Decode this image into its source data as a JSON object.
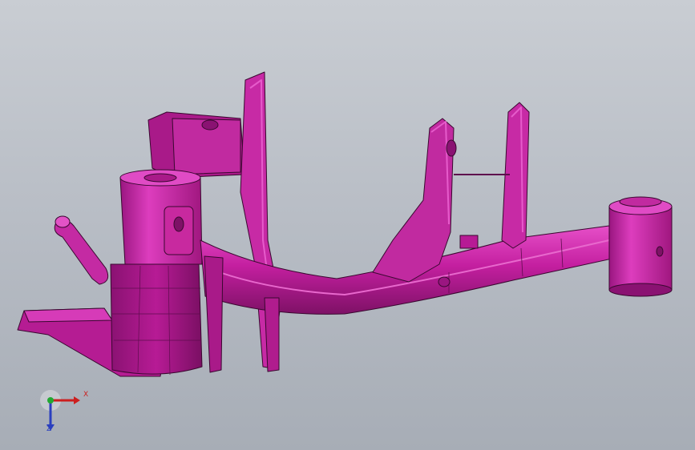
{
  "viewport": {
    "background_top": "#c9cdd3",
    "background_bottom": "#a7adb6"
  },
  "model": {
    "name_icon": "rear-subframe-part-icon",
    "color": "#c41fa0",
    "highlight_color": "#e23cc4",
    "shadow_color": "#7e1166",
    "edge_color": "#3a0830"
  },
  "triad": {
    "x_label": "X",
    "z_label": "Z",
    "x_color": "#cc1e1e",
    "y_color": "#22a832",
    "z_color": "#2a3fbf"
  }
}
